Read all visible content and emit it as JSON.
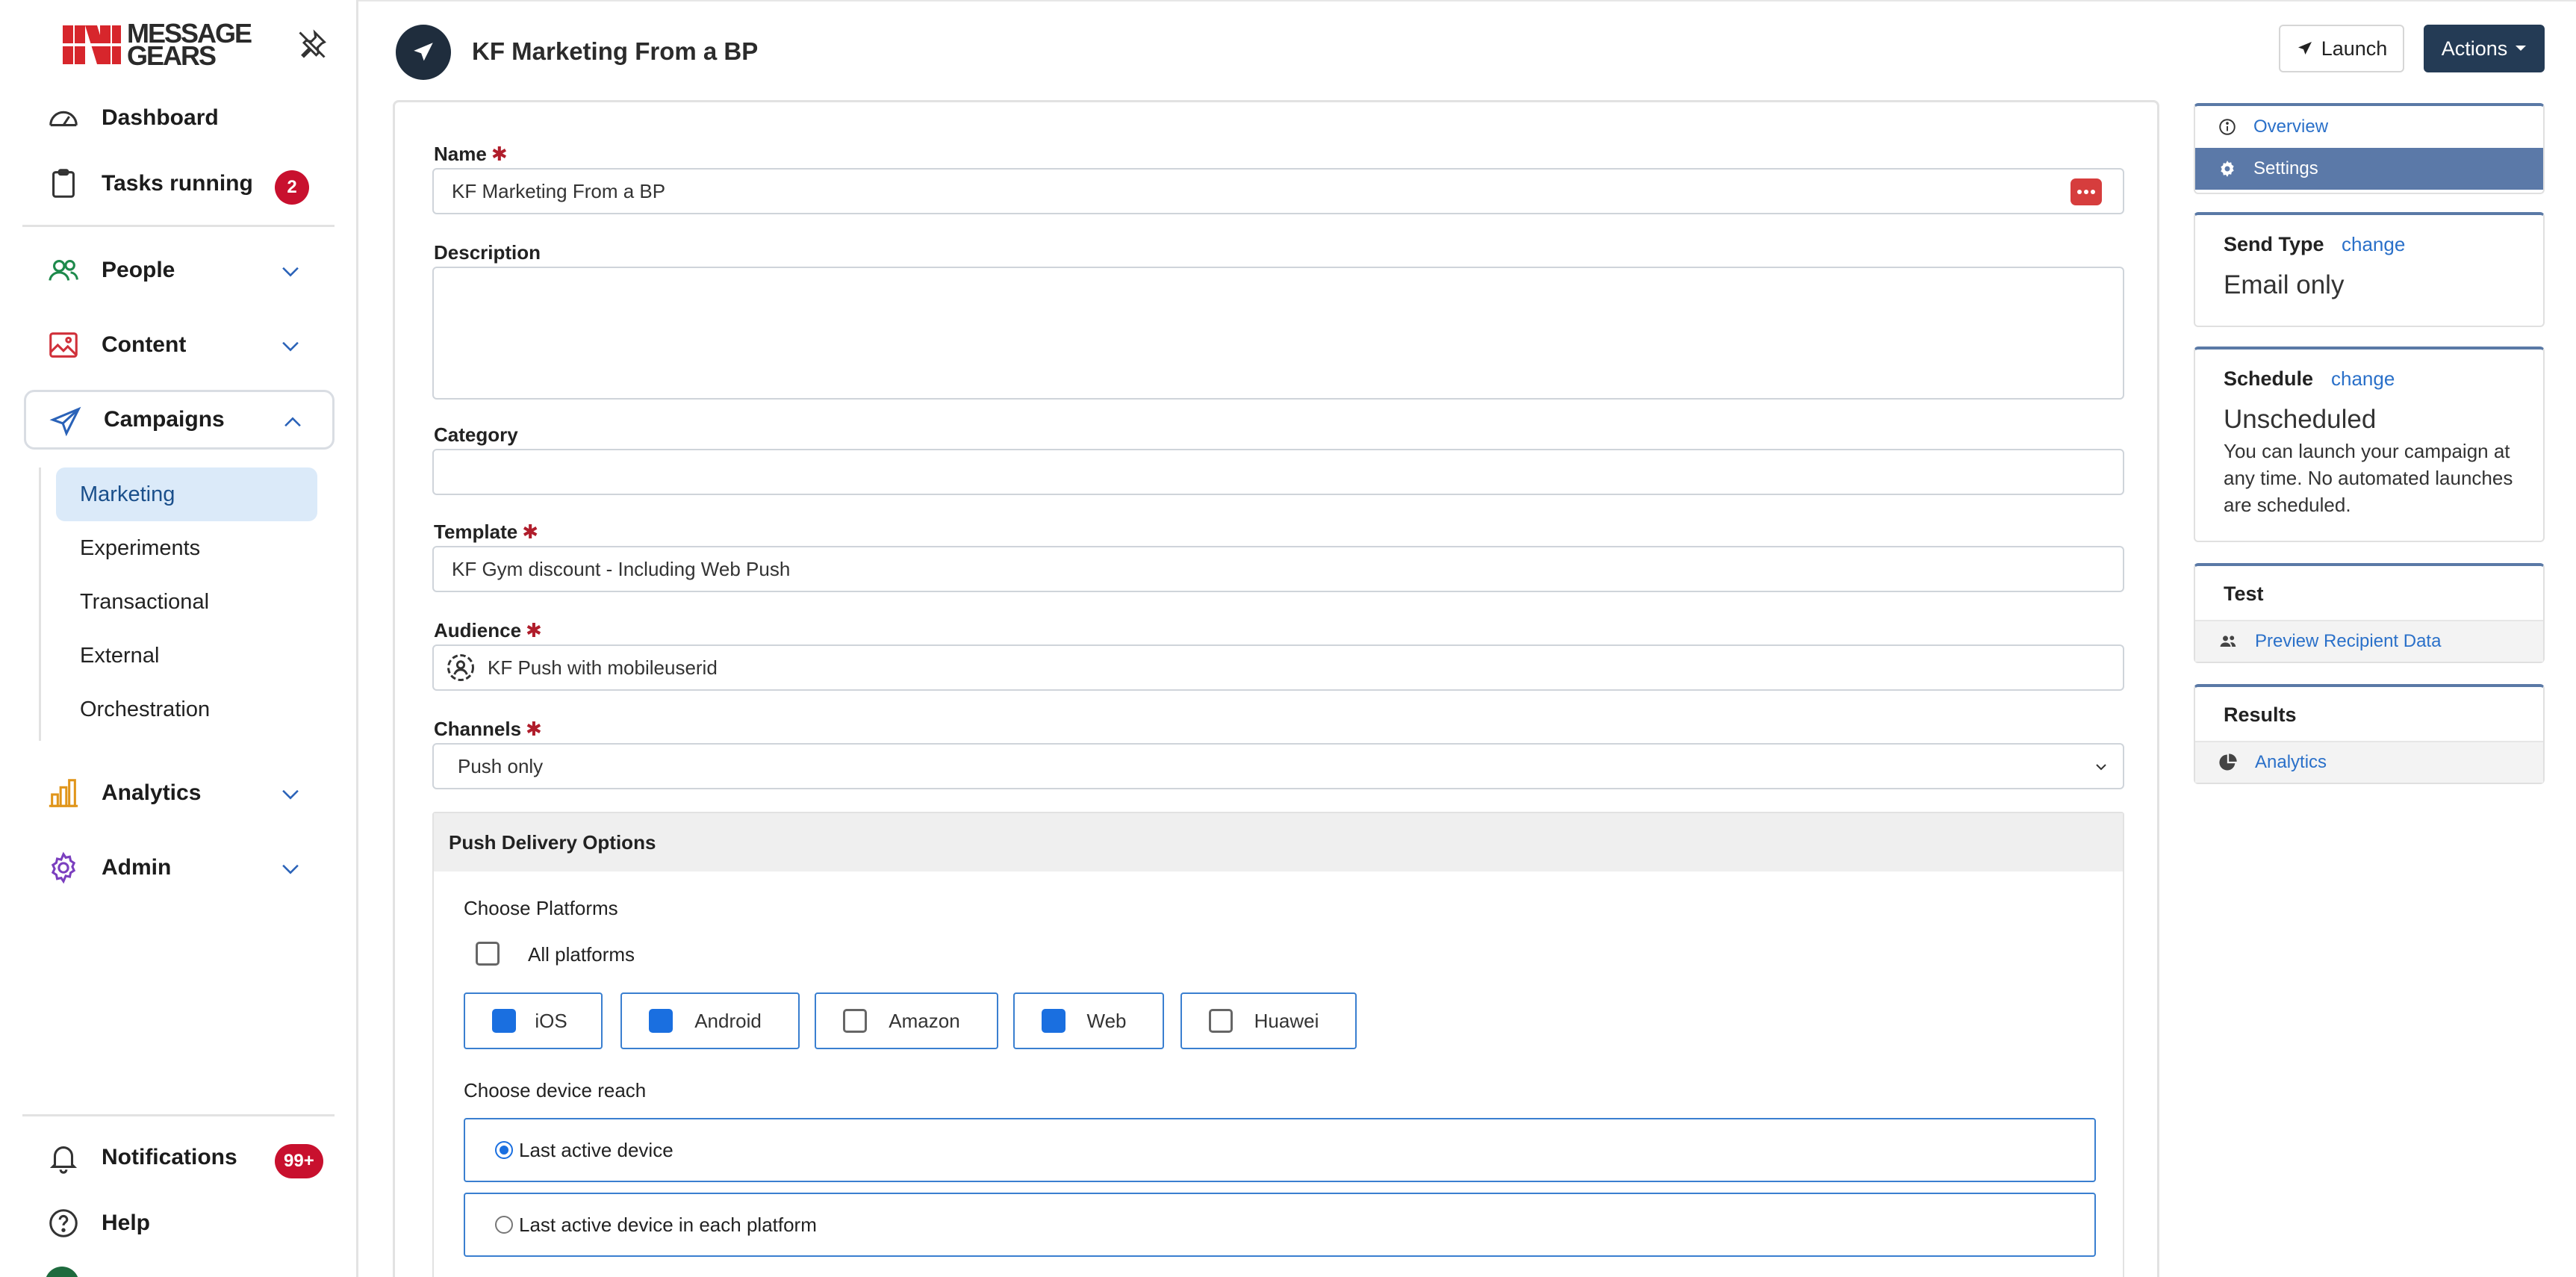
{
  "brand": {
    "logo_line1": "MESSAGE",
    "logo_line2": "GEARS",
    "accent": "#c8102e"
  },
  "sidebar": {
    "dashboard": "Dashboard",
    "tasks": {
      "label": "Tasks running",
      "count": "2"
    },
    "people": "People",
    "content": "Content",
    "campaigns": "Campaigns",
    "campaign_items": [
      "Marketing",
      "Experiments",
      "Transactional",
      "External",
      "Orchestration"
    ],
    "analytics": "Analytics",
    "admin": "Admin",
    "notifications": {
      "label": "Notifications",
      "count": "99+"
    },
    "help": "Help"
  },
  "header": {
    "title": "KF Marketing From a BP",
    "launch_label": "Launch",
    "actions_label": "Actions"
  },
  "form": {
    "name": {
      "label": "Name",
      "value": "KF Marketing From a BP"
    },
    "description": {
      "label": "Description",
      "value": ""
    },
    "category": {
      "label": "Category",
      "value": ""
    },
    "template": {
      "label": "Template",
      "value": "KF Gym discount - Including Web Push"
    },
    "audience": {
      "label": "Audience",
      "value": "KF Push with mobileuserid"
    },
    "channels": {
      "label": "Channels",
      "value": "Push only"
    },
    "required_mark": "✱"
  },
  "push": {
    "title": "Push Delivery Options",
    "choose_platforms": "Choose Platforms",
    "all_platforms": "All platforms",
    "platforms": [
      {
        "label": "iOS",
        "checked": true
      },
      {
        "label": "Android",
        "checked": true
      },
      {
        "label": "Amazon",
        "checked": false
      },
      {
        "label": "Web",
        "checked": true
      },
      {
        "label": "Huawei",
        "checked": false
      }
    ],
    "choose_reach": "Choose device reach",
    "reach_options": [
      "Last active device",
      "Last active device in each platform"
    ],
    "reach_selected": 0
  },
  "right": {
    "overview": "Overview",
    "settings": "Settings",
    "send_type": {
      "title": "Send Type",
      "change": "change",
      "value": "Email only"
    },
    "schedule": {
      "title": "Schedule",
      "change": "change",
      "value": "Unscheduled",
      "desc": "You can launch your campaign at any time. No automated launches are scheduled."
    },
    "test": {
      "title": "Test",
      "link": "Preview Recipient Data"
    },
    "results": {
      "title": "Results",
      "link": "Analytics"
    }
  }
}
